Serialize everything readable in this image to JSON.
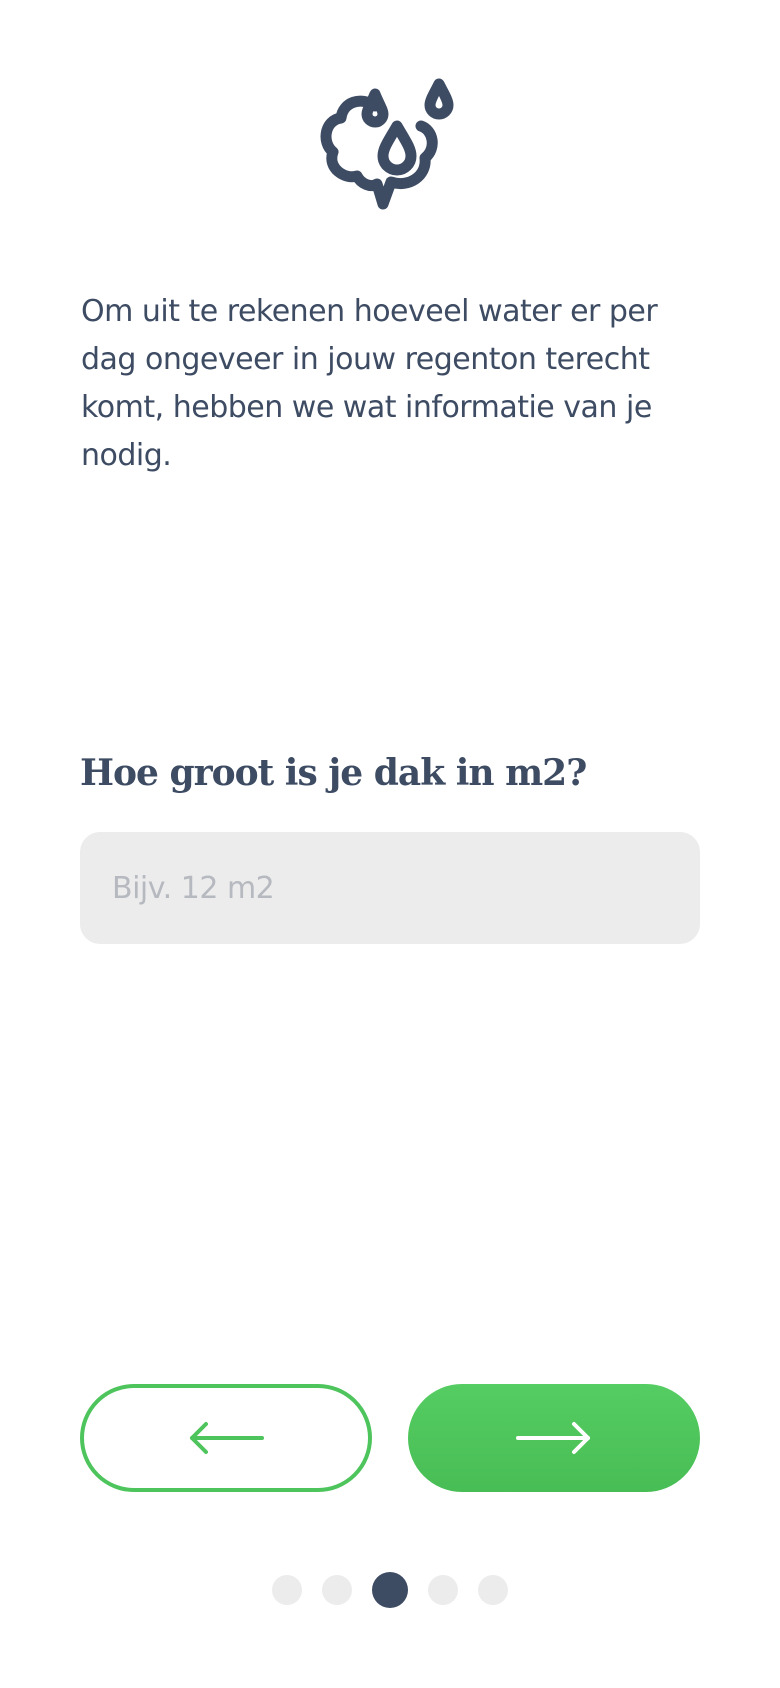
{
  "intro": {
    "text": "Om uit te rekenen hoeveel water er per dag ongeveer in jouw regenton terecht komt, hebben we wat informatie van je nodig."
  },
  "question": {
    "label": "Hoe groot is je dak in m2?"
  },
  "roof_input": {
    "value": "",
    "placeholder": "Bijv. 12 m2"
  },
  "navigation": {
    "back_icon": "arrow-left-icon",
    "next_icon": "arrow-right-icon"
  },
  "pagination": {
    "total_steps": 5,
    "current_step": 3
  },
  "colors": {
    "text": "#3d4b63",
    "accent_green": "#4ec45c",
    "input_bg": "#ececec",
    "placeholder": "#b6b9bf",
    "dot_inactive": "#ececec",
    "dot_active": "#3d4b63"
  },
  "icons": {
    "logo": "brain-rain-drops-icon"
  }
}
